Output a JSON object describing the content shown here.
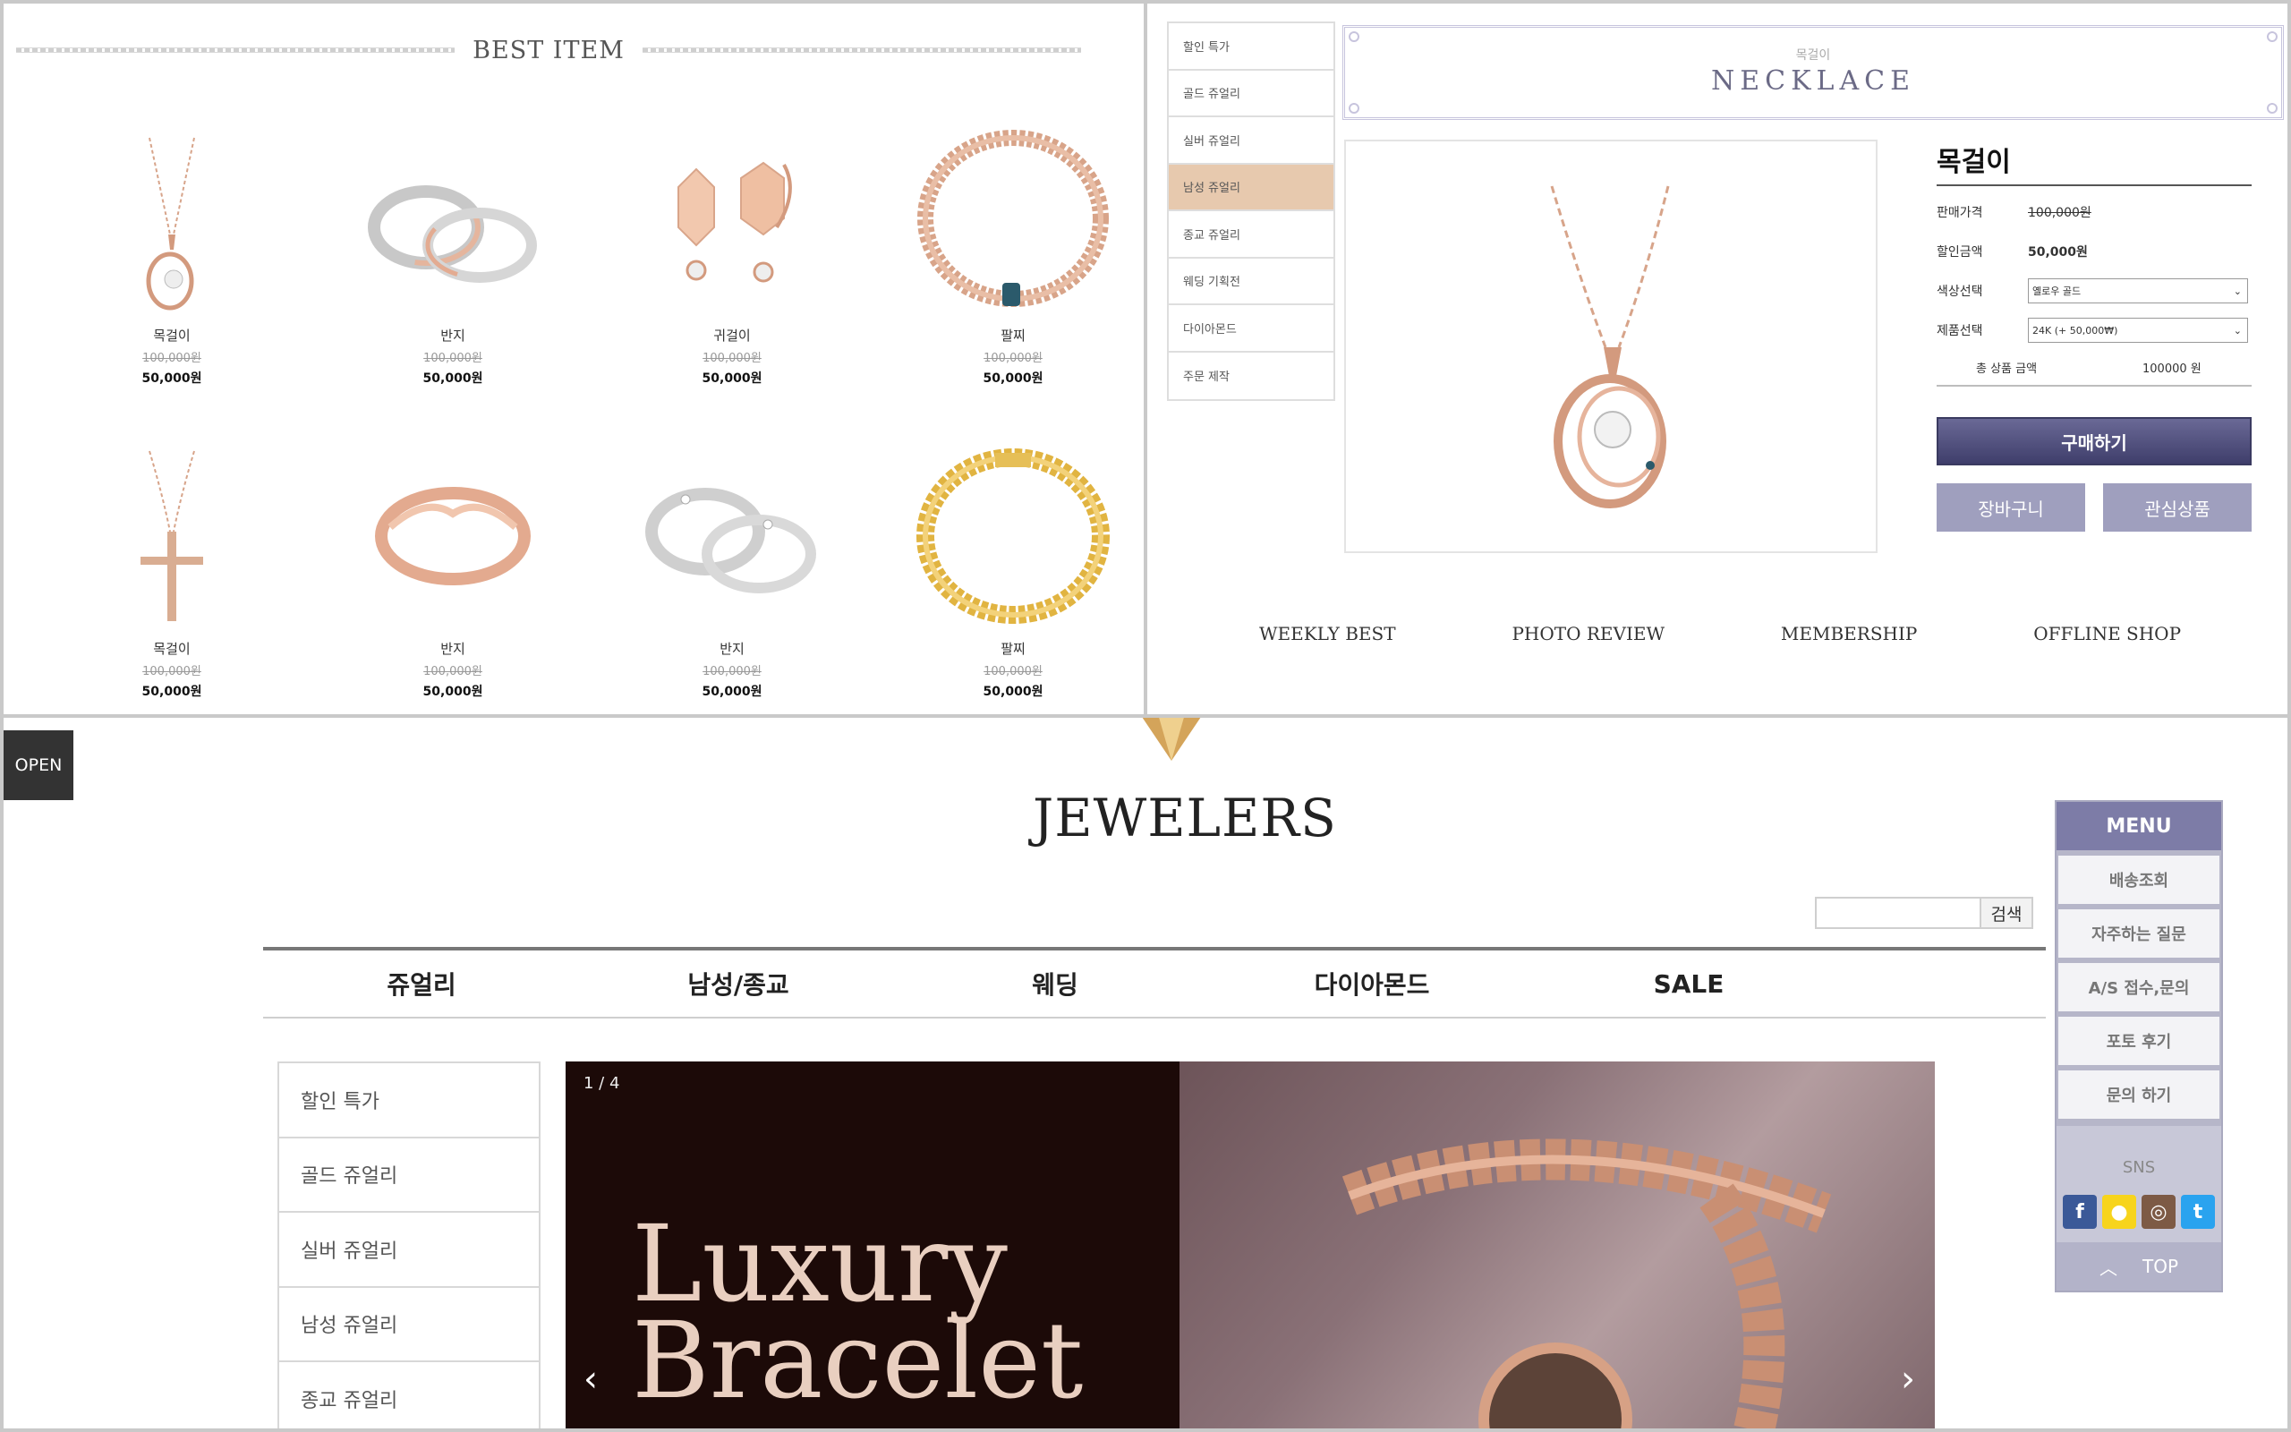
{
  "best": {
    "title": "BEST ITEM",
    "items": [
      {
        "name": "목걸이",
        "old": "100,000원",
        "price": "50,000원"
      },
      {
        "name": "반지",
        "old": "100,000원",
        "price": "50,000원"
      },
      {
        "name": "귀걸이",
        "old": "100,000원",
        "price": "50,000원"
      },
      {
        "name": "팔찌",
        "old": "100,000원",
        "price": "50,000원"
      },
      {
        "name": "목걸이",
        "old": "100,000원",
        "price": "50,000원"
      },
      {
        "name": "반지",
        "old": "100,000원",
        "price": "50,000원"
      },
      {
        "name": "반지",
        "old": "100,000원",
        "price": "50,000원"
      },
      {
        "name": "팔찌",
        "old": "100,000원",
        "price": "50,000원"
      }
    ]
  },
  "detail": {
    "categories": [
      "할인 특가",
      "골드 쥬얼리",
      "실버 쥬얼리",
      "남성 쥬얼리",
      "종교 쥬얼리",
      "웨딩 기획전",
      "다이아몬드",
      "주문 제작"
    ],
    "active_category": "남성 쥬얼리",
    "banner_small": "목걸이",
    "banner_big": "NECKLACE",
    "product_title": "목걸이",
    "rows": {
      "sale_price_label": "판매가격",
      "sale_price": "100,000원",
      "discount_label": "할인금액",
      "discount": "50,000원",
      "color_label": "색상선택",
      "color_value": "옐로우 골드",
      "product_label": "제품선택",
      "product_value": "24K (+ 50,000₩)",
      "total_label": "총 상품 금액",
      "total_value": "100000 원"
    },
    "buy": "구매하기",
    "cart": "장바구니",
    "wish": "관심상품",
    "links": [
      "WEEKLY BEST",
      "PHOTO REVIEW",
      "MEMBERSHIP",
      "OFFLINE SHOP"
    ]
  },
  "main": {
    "open": "OPEN",
    "logo": "JEWELERS",
    "search_button": "검색",
    "search_placeholder": "",
    "gnb": [
      "쥬얼리",
      "남성/종교",
      "웨딩",
      "다이아몬드",
      "SALE"
    ],
    "side": [
      "할인 특가",
      "골드 쥬얼리",
      "실버 쥬얼리",
      "남성 쥬얼리",
      "종교 쥬얼리"
    ],
    "slide_counter": "1 / 4",
    "slide_line1": "Luxury",
    "slide_line2": "Bracelet",
    "prev": "‹",
    "next": "›",
    "quick": {
      "header": "MENU",
      "items": [
        "배송조회",
        "자주하는 질문",
        "A/S 접수,문의",
        "포토 후기",
        "문의 하기"
      ],
      "sns": "SNS",
      "top": "TOP"
    }
  },
  "colors": {
    "accent": "#4a4978",
    "rose": "#e7c9ae",
    "slide_bg": "#1c0a08"
  }
}
